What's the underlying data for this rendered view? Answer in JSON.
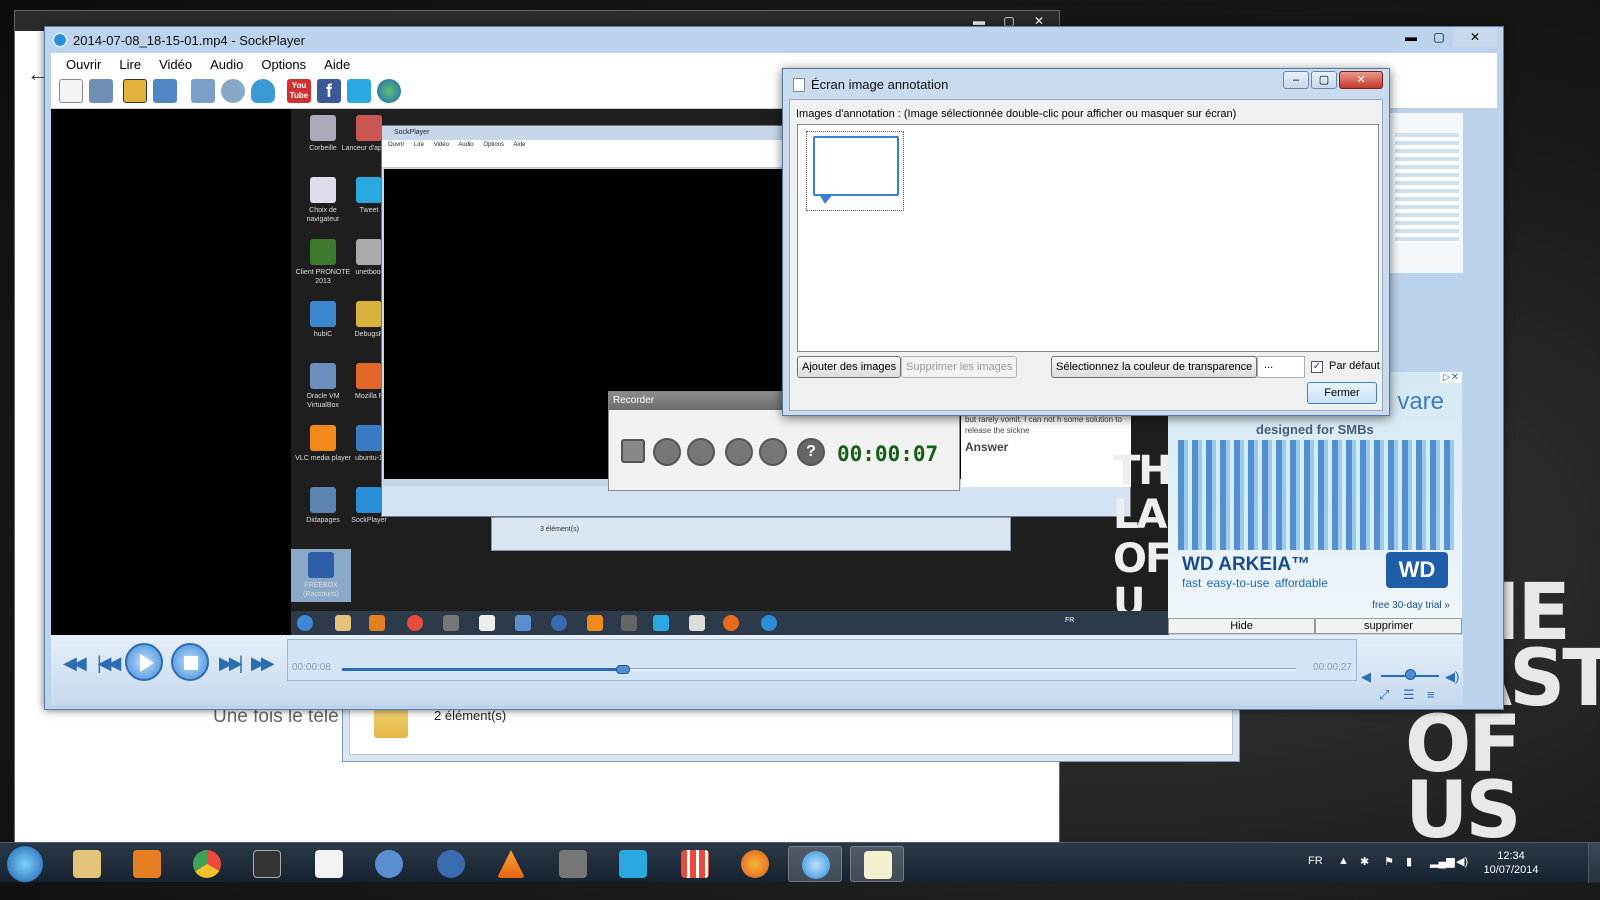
{
  "desktop": {
    "bg_title_lines": [
      "THE",
      "LAST",
      "OF US"
    ]
  },
  "browser": {
    "partial_text": "Une fois le télé"
  },
  "explorer": {
    "status": "2 élément(s)"
  },
  "main_window": {
    "title": "2014-07-08_18-15-01.mp4 - SockPlayer",
    "controls": {
      "minimize": "▬",
      "maximize": "▢",
      "close": "✕"
    },
    "menu": [
      "Ouvrir",
      "Lire",
      "Vidéo",
      "Audio",
      "Options",
      "Aide"
    ],
    "toolbar_icons": [
      "new-file-icon",
      "open-folder-icon",
      "capture-icon",
      "screenshot-icon",
      "screen-record-icon",
      "webcam-icon",
      "microphone-icon",
      "youtube-icon",
      "facebook-icon",
      "twitter-icon",
      "web-globe-icon"
    ],
    "youtube_label": "You Tube",
    "facebook_label": "f",
    "player": {
      "time_elapsed": "00:00:08",
      "time_total": "00:00:27",
      "progress": 0.295,
      "volume": 0.5
    }
  },
  "nested": {
    "desktop_icons": [
      {
        "label": "Corbeille"
      },
      {
        "label": "Lanceur d'applica"
      },
      {
        "label": "Choix de navigateur"
      },
      {
        "label": "Tweet"
      },
      {
        "label": "Client PRONOTE 2013"
      },
      {
        "label": "unetboot"
      },
      {
        "label": "hubiC"
      },
      {
        "label": "DebugsP"
      },
      {
        "label": "Oracle VM VirtualBox"
      },
      {
        "label": "Mozilla F"
      },
      {
        "label": "VLC media player"
      },
      {
        "label": "ubuntu-1"
      },
      {
        "label": "Didapages"
      },
      {
        "label": "SockPlayer"
      },
      {
        "label": "FREEBOX (Raccourci)"
      }
    ],
    "sockplayer_title": "SockPlayer",
    "sockplayer_menu": [
      "Ouvrir",
      "Lire",
      "Vidéo",
      "Audio",
      "Options",
      "Aide"
    ],
    "explorer_status": "3 élément(s)",
    "page_text": "I am a new pregant woman, and I m nausea, but rarely vomit. I can not h some solution to release the sickne",
    "page_heading": "Answer",
    "hide_label": "Hide",
    "remove_label": "supprimer",
    "big_text_lines": [
      "THE",
      "LAS",
      "OF U"
    ],
    "tray_lang": "FR"
  },
  "recorder": {
    "title": "Recorder",
    "time": "00:00:07",
    "buttons": [
      "file-icon",
      "record-icon",
      "stop-icon",
      "annotation-icon",
      "folder-icon",
      "help-icon"
    ]
  },
  "ad": {
    "brand": "vare",
    "tagline": "designed for SMBs",
    "product": "WD ARKEIA™",
    "features": "fast   easy-to-use   affordable",
    "logo": "WD",
    "trial": "free 30-day trial »",
    "hide": "Hide",
    "remove": "supprimer"
  },
  "dialog": {
    "title": "Écran image annotation",
    "label": "Images d'annotation : (Image sélectionnée double-clic pour afficher ou masquer sur écran)",
    "add_button": "Ajouter des images",
    "remove_button": "Supprimer les images",
    "color_button": "Sélectionnez la couleur de transparence",
    "color_value": "...",
    "default_checkbox": "Par défaut",
    "default_checked": true,
    "close_button": "Fermer"
  },
  "taskbar": {
    "apps": [
      "explorer",
      "media-player",
      "chrome",
      "inkscape",
      "notepad",
      "thunderbird",
      "eclipse",
      "vlc",
      "gimp",
      "twitter",
      "launcher",
      "firefox",
      "sockplayer",
      "annotation"
    ],
    "lang": "FR",
    "time": "12:34",
    "date": "10/07/2014"
  },
  "colors": {
    "accent": "#2a6cb6",
    "recorder_time": "#155e15",
    "titlebar": "#bcd3ee"
  }
}
